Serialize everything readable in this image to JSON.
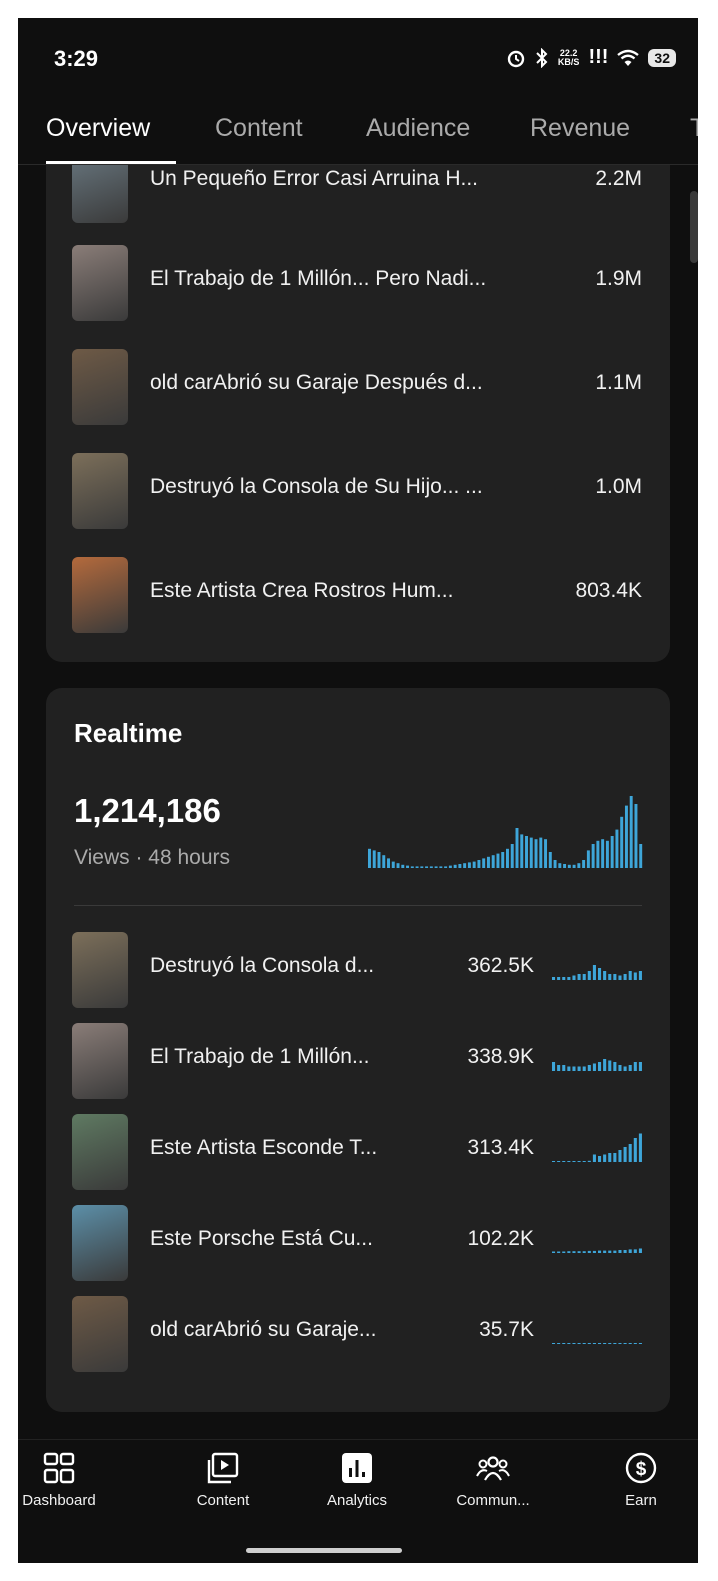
{
  "status_bar": {
    "time": "3:29",
    "net_speed_top": "22.2",
    "net_speed_unit": "KB/S",
    "signal": "!!!",
    "battery": "32"
  },
  "tabs": [
    {
      "label": "Overview",
      "active": true
    },
    {
      "label": "Content",
      "active": false
    },
    {
      "label": "Audience",
      "active": false
    },
    {
      "label": "Revenue",
      "active": false
    },
    {
      "label": "T",
      "active": false
    }
  ],
  "top_content": [
    {
      "title": "Un Pequeño Error Casi Arruina H...",
      "value": "2.2M",
      "thumb": "#6b7a83"
    },
    {
      "title": "El Trabajo de 1 Millón... Pero Nadi...",
      "value": "1.9M",
      "thumb": "#8a7d78"
    },
    {
      "title": "old carAbrió su Garaje Después d...",
      "value": "1.1M",
      "thumb": "#6e5a46"
    },
    {
      "title": "Destruyó la Consola de Su Hijo... ...",
      "value": "1.0M",
      "thumb": "#7c6f5a"
    },
    {
      "title": "Este Artista Crea Rostros Hum...",
      "value": "803.4K",
      "thumb": "#b46a3c"
    }
  ],
  "realtime": {
    "title": "Realtime",
    "views": "1,214,186",
    "caption": "Views · 48 hours",
    "accent": "#3ea6d9",
    "bars": [
      0.24,
      0.22,
      0.2,
      0.16,
      0.12,
      0.08,
      0.06,
      0.04,
      0.03,
      0.02,
      0.02,
      0.02,
      0.02,
      0.02,
      0.02,
      0.02,
      0.02,
      0.03,
      0.04,
      0.05,
      0.06,
      0.07,
      0.08,
      0.1,
      0.12,
      0.14,
      0.16,
      0.18,
      0.2,
      0.24,
      0.3,
      0.5,
      0.42,
      0.4,
      0.38,
      0.36,
      0.38,
      0.36,
      0.2,
      0.1,
      0.06,
      0.05,
      0.04,
      0.04,
      0.06,
      0.1,
      0.22,
      0.3,
      0.34,
      0.36,
      0.34,
      0.4,
      0.48,
      0.64,
      0.78,
      0.9,
      0.8,
      0.3
    ],
    "items": [
      {
        "title": "Destruyó la Consola d...",
        "value": "362.5K",
        "thumb": "#7c6f5a",
        "spark": [
          0.1,
          0.1,
          0.1,
          0.1,
          0.15,
          0.2,
          0.2,
          0.3,
          0.5,
          0.4,
          0.3,
          0.2,
          0.2,
          0.15,
          0.2,
          0.3,
          0.25,
          0.3
        ]
      },
      {
        "title": "El Trabajo de 1 Millón...",
        "value": "338.9K",
        "thumb": "#8a7d78",
        "spark": [
          0.3,
          0.2,
          0.2,
          0.15,
          0.15,
          0.15,
          0.15,
          0.2,
          0.25,
          0.3,
          0.4,
          0.35,
          0.3,
          0.2,
          0.15,
          0.2,
          0.3,
          0.3
        ]
      },
      {
        "title": "Este Artista Esconde T...",
        "value": "313.4K",
        "thumb": "#5f7a62",
        "spark": [
          0.02,
          0.02,
          0.02,
          0.02,
          0.02,
          0.03,
          0.03,
          0.04,
          0.25,
          0.2,
          0.25,
          0.3,
          0.3,
          0.4,
          0.5,
          0.6,
          0.8,
          0.95
        ]
      },
      {
        "title": "Este Porsche Está Cu...",
        "value": "102.2K",
        "thumb": "#5c8fa8",
        "spark": [
          0.05,
          0.05,
          0.05,
          0.06,
          0.06,
          0.06,
          0.06,
          0.07,
          0.07,
          0.08,
          0.08,
          0.08,
          0.08,
          0.1,
          0.1,
          0.12,
          0.12,
          0.15
        ]
      },
      {
        "title": "old carAbrió su Garaje...",
        "value": "35.7K",
        "thumb": "#6e5a46",
        "spark": [
          0.02,
          0.02,
          0.02,
          0.02,
          0.02,
          0.02,
          0.02,
          0.02,
          0.03,
          0.03,
          0.03,
          0.03,
          0.03,
          0.03,
          0.03,
          0.03,
          0.03,
          0.03
        ]
      }
    ]
  },
  "bottom_nav": [
    {
      "label": "Dashboard",
      "icon": "dashboard-icon"
    },
    {
      "label": "Content",
      "icon": "content-icon"
    },
    {
      "label": "Analytics",
      "icon": "analytics-icon"
    },
    {
      "label": "Commun...",
      "icon": "community-icon"
    },
    {
      "label": "Earn",
      "icon": "earn-icon"
    }
  ]
}
